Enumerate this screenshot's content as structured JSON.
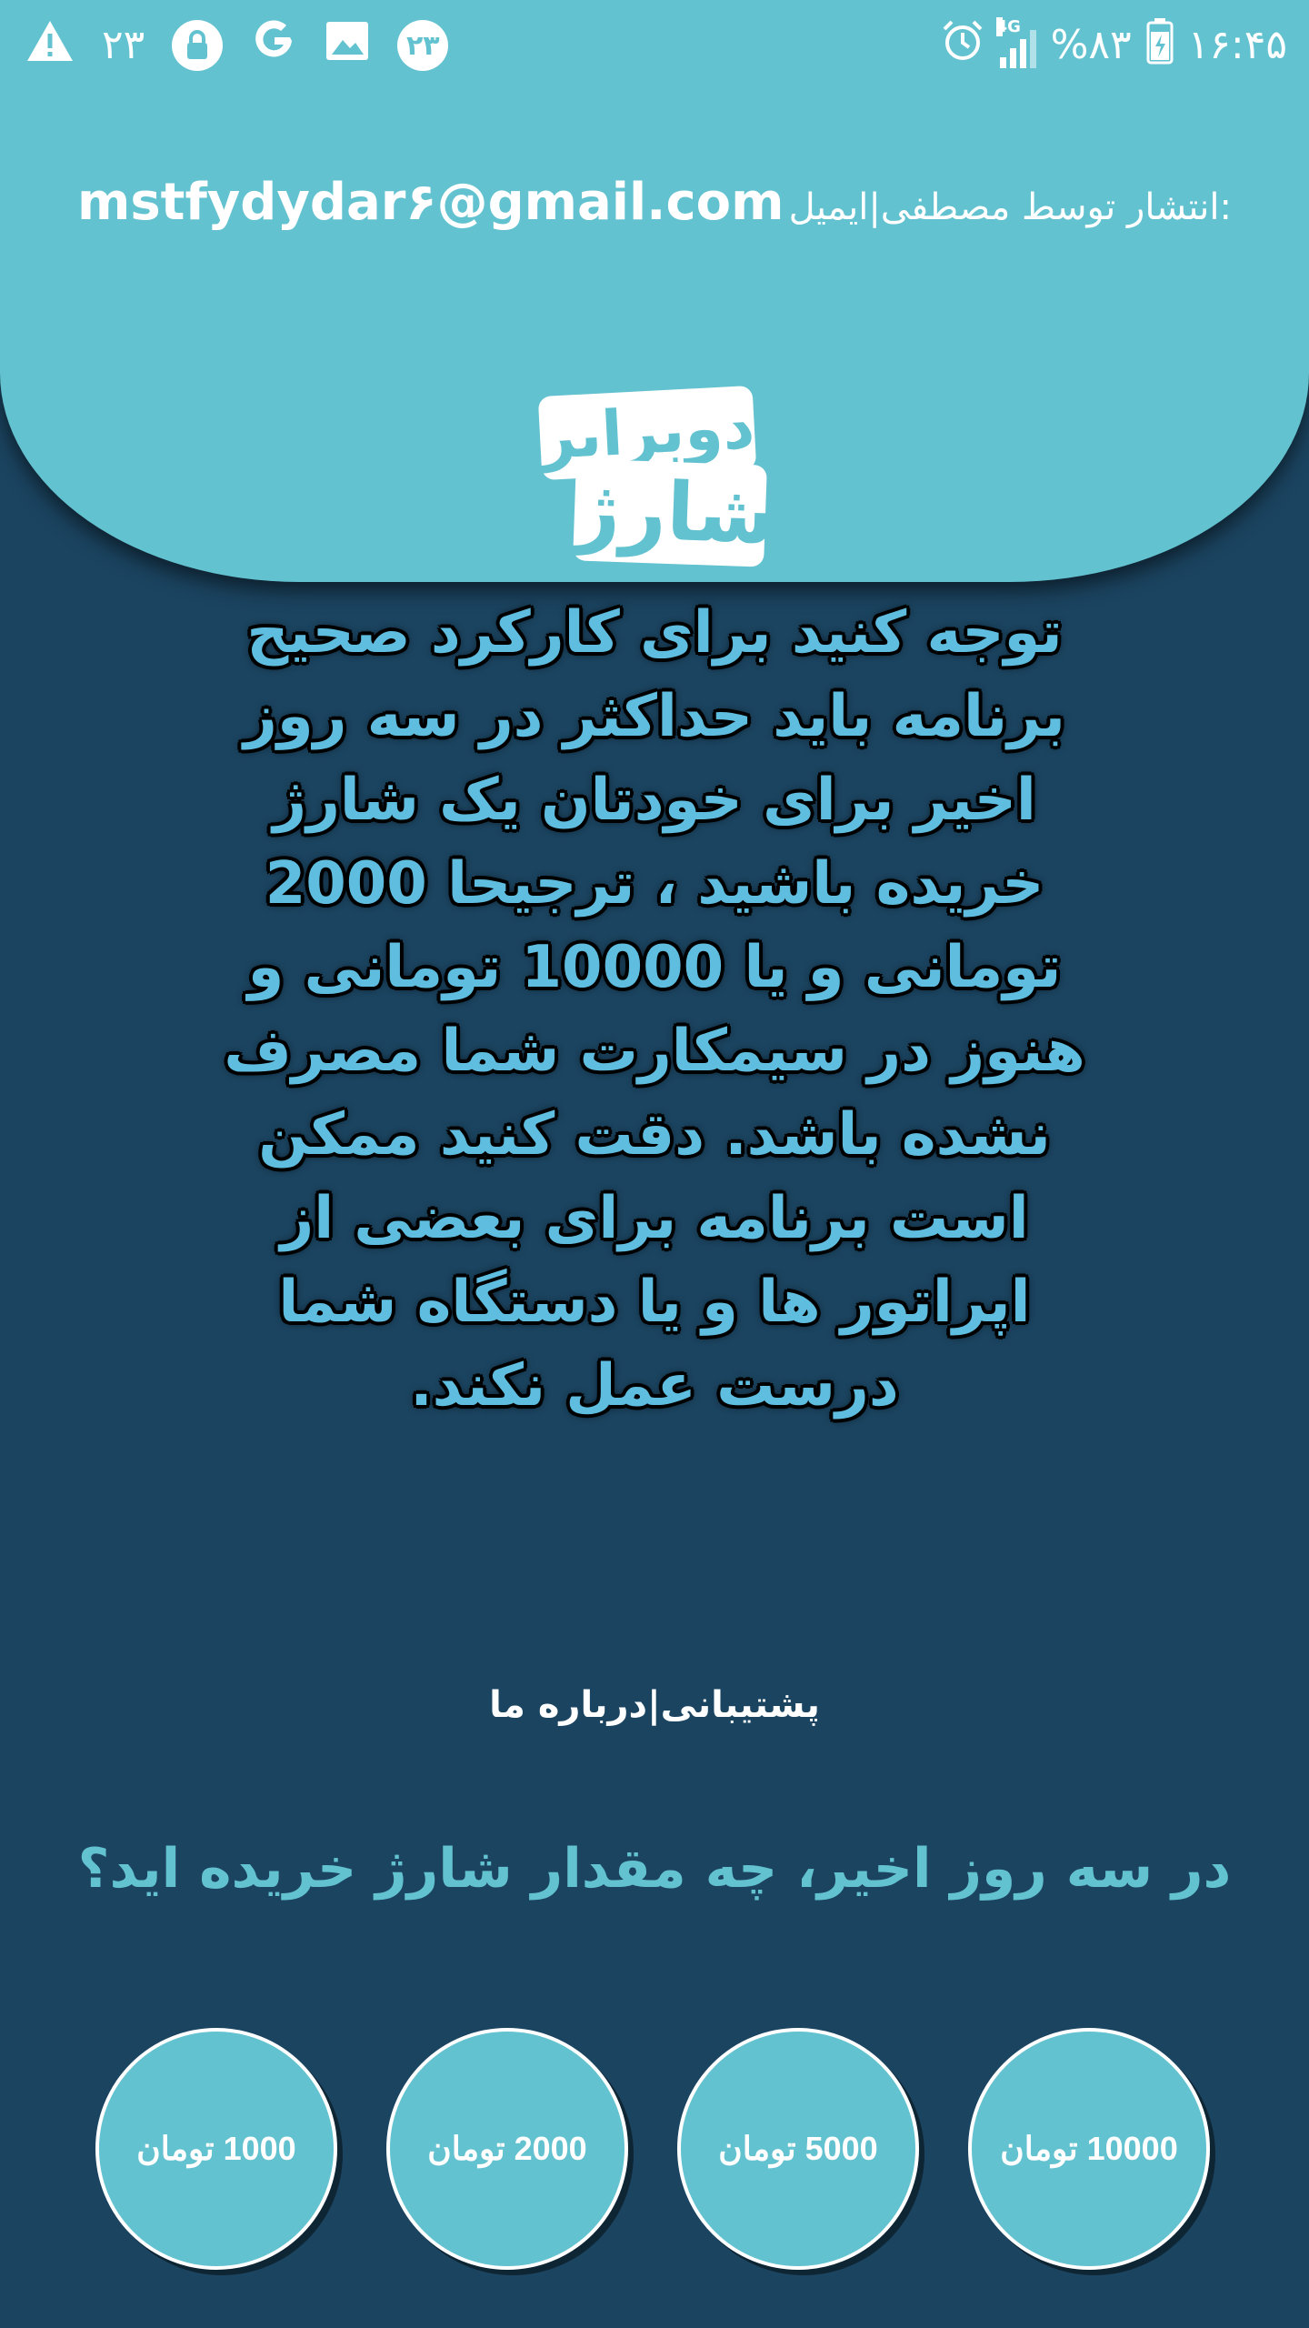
{
  "status_bar": {
    "left_number": "۲۳",
    "badge_number": "۲۳",
    "battery": "%۸۳",
    "time": "۱۶:۴۵",
    "network": "4G",
    "icons": [
      "warning-icon",
      "lock-icon",
      "google-icon",
      "image-icon",
      "alarm-icon",
      "signal-icon",
      "battery-icon"
    ]
  },
  "header": {
    "email_address": "mstfydydar۶@gmail.com",
    "email_prefix": "انتشار توسط مصطفی|ایمیل:",
    "logo_top": "دوبرابر",
    "logo_bottom": "شارژ"
  },
  "notice": {
    "text": "توجه کنید برای کارکرد صحیح برنامه باید حداکثر در سه روز اخیر برای خودتان یک شارژ خریده باشید ، ترجیحا 2000 تومانی و یا 10000 تومانی و هنوز در سیمکارت شما مصرف نشده باشد. دقت کنید ممکن است برنامه برای بعضی از اپراتور ها و یا دستگاه شما درست عمل نکند."
  },
  "links": {
    "support": "پشتیبانی",
    "separator": "|",
    "about": "درباره ما"
  },
  "question": {
    "text": "در سه روز اخیر، چه مقدار شارژ خریده اید؟"
  },
  "amounts": [
    {
      "label": "10000 تومان"
    },
    {
      "label": "5000 تومان"
    },
    {
      "label": "2000 تومان"
    },
    {
      "label": "1000 تومان"
    }
  ],
  "colors": {
    "header": "#63c2d0",
    "background": "#1b4460",
    "notice_text": "#5fbde0"
  }
}
